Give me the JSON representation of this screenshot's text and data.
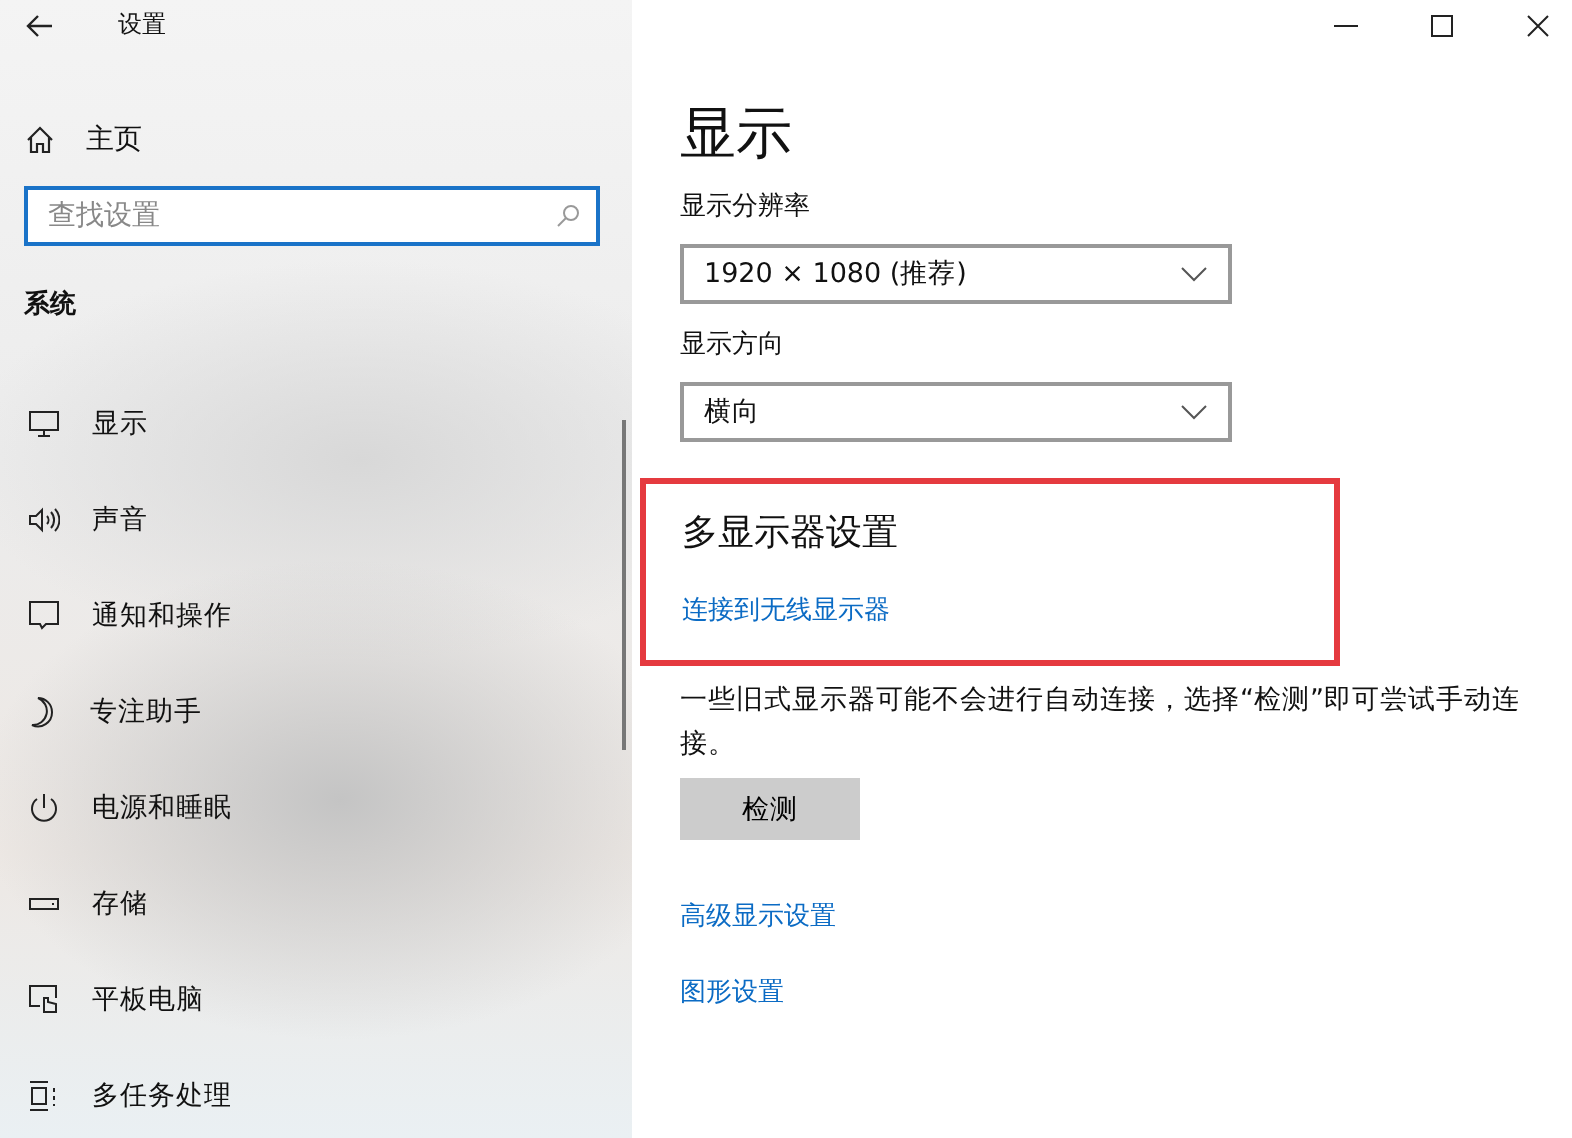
{
  "window": {
    "title": "设置"
  },
  "sidebar": {
    "home": "主页",
    "search": {
      "placeholder": "查找设置"
    },
    "section": "系统",
    "items": [
      {
        "label": "显示",
        "kind": "display"
      },
      {
        "label": "声音",
        "kind": "sound"
      },
      {
        "label": "通知和操作",
        "kind": "notify"
      },
      {
        "label": "专注助手",
        "kind": "moon"
      },
      {
        "label": "电源和睡眠",
        "kind": "power"
      },
      {
        "label": "存储",
        "kind": "storage"
      },
      {
        "label": "平板电脑",
        "kind": "tablet"
      },
      {
        "label": "多任务处理",
        "kind": "multitask"
      }
    ]
  },
  "page": {
    "title": "显示",
    "dropdowns": [
      {
        "label": "显示分辨率",
        "value": "1920 × 1080 (推荐)"
      },
      {
        "label": "显示方向",
        "value": "横向"
      }
    ],
    "multi_display": {
      "highlighted": true,
      "heading": "多显示器设置",
      "link": "连接到无线显示器"
    },
    "note": "一些旧式显示器可能不会进行自动连接，选择“检测”即可尝试手动连接。",
    "button": "检测",
    "links": [
      "高级显示设置",
      "图形设置"
    ]
  }
}
